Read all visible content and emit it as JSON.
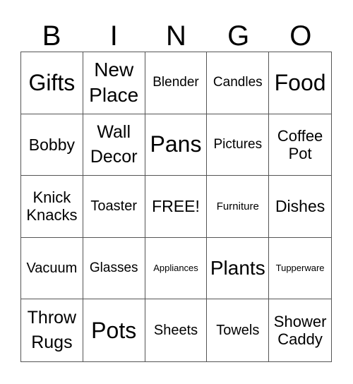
{
  "header": {
    "letters": [
      "B",
      "I",
      "N",
      "G",
      "O"
    ]
  },
  "card": {
    "cells": [
      "Gifts",
      "New Place",
      "Blender",
      "Candles",
      "Food",
      "Bobby",
      "Wall Decor",
      "Pans",
      "Pictures",
      "Coffee Pot",
      "Knick Knacks",
      "Toaster",
      "FREE!",
      "Furniture",
      "Dishes",
      "Vacuum",
      "Glasses",
      "Appliances",
      "Plants",
      "Tupperware",
      "Throw Rugs",
      "Pots",
      "Sheets",
      "Towels",
      "Shower Caddy"
    ],
    "free_space": "FREE!"
  },
  "colors": {
    "grid_line": "#555555",
    "text": "#000000",
    "background": "#ffffff"
  }
}
